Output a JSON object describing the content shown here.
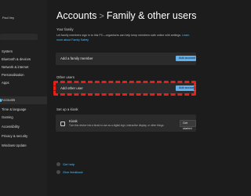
{
  "sidebar": {
    "user_name": "Paul Vey",
    "items": [
      {
        "label": "System"
      },
      {
        "label": "Bluetooth & devices"
      },
      {
        "label": "Network & internet"
      },
      {
        "label": "Personalisation"
      },
      {
        "label": "Apps"
      },
      {
        "label": "Accounts"
      },
      {
        "label": "Time & language"
      },
      {
        "label": "Gaming"
      },
      {
        "label": "Accessibility"
      },
      {
        "label": "Privacy & security"
      },
      {
        "label": "Windows Update"
      }
    ]
  },
  "header": {
    "parent": "Accounts",
    "separator": ">",
    "current": "Family & other users"
  },
  "family": {
    "heading": "Your family",
    "description": "Let family members sign in to this PC—organisers can help keep members safe online with settings.",
    "learn_link": "Learn more about Family Safety",
    "add_label": "Add a family member",
    "add_button": "Add account"
  },
  "other_users": {
    "heading": "Other users",
    "add_label": "Add other user",
    "add_button": "Add account"
  },
  "kiosk": {
    "heading": "Set up a kiosk",
    "title": "Kiosk",
    "description": "Turn this device into a kiosk to use as a digital sign, interactive display, or other things",
    "button": "Get started"
  },
  "help": {
    "get_help": "Get help",
    "feedback": "Give feedback"
  }
}
